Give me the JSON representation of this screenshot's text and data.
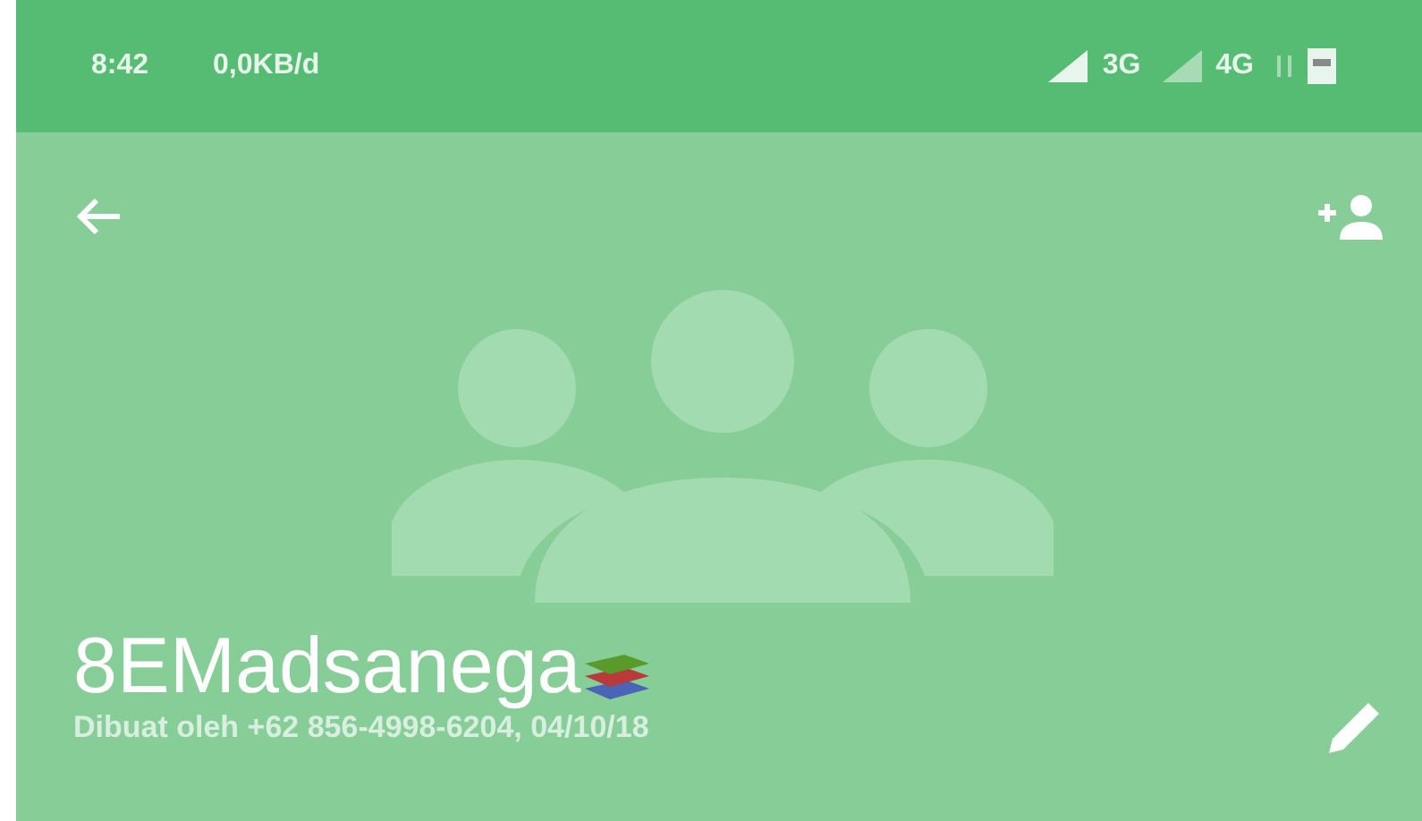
{
  "status_bar": {
    "time": "8:42",
    "data_rate": "0,0KB/d",
    "network_1": "3G",
    "network_2": "4G"
  },
  "group": {
    "name": "8EMadsanega",
    "subtitle": "Dibuat oleh +62 856-4998-6204, 04/10/18"
  }
}
